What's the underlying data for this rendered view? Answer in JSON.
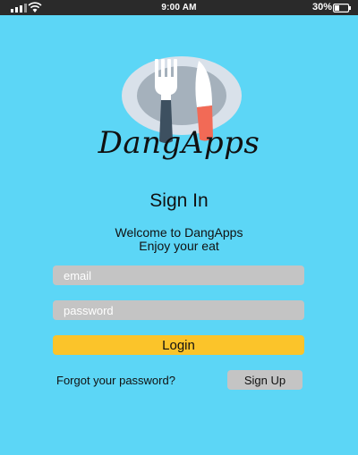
{
  "status_bar": {
    "time": "9:00 AM",
    "battery": "30%",
    "icons": [
      "signal-icon",
      "wifi-icon",
      "battery-icon"
    ]
  },
  "logo": {
    "icon": "plate-fork-knife-icon",
    "app_name": "DangApps"
  },
  "signin": {
    "title": "Sign In",
    "welcome_line1": "Welcome to DangApps",
    "welcome_line2": "Enjoy your eat",
    "email_placeholder": "email",
    "email_value": "",
    "password_placeholder": "password",
    "password_value": "",
    "login_label": "Login",
    "forgot_label": "Forgot your password?",
    "signup_label": "Sign Up"
  },
  "colors": {
    "background": "#5cd6f6",
    "status_bar": "#2a2a2a",
    "field": "#c4c4c4",
    "login_button": "#fbc42a",
    "plate_outer": "#d9e1ea",
    "plate_inner": "#a5b1bc",
    "fork_handle": "#3d5060",
    "knife_handle": "#f26a56"
  }
}
